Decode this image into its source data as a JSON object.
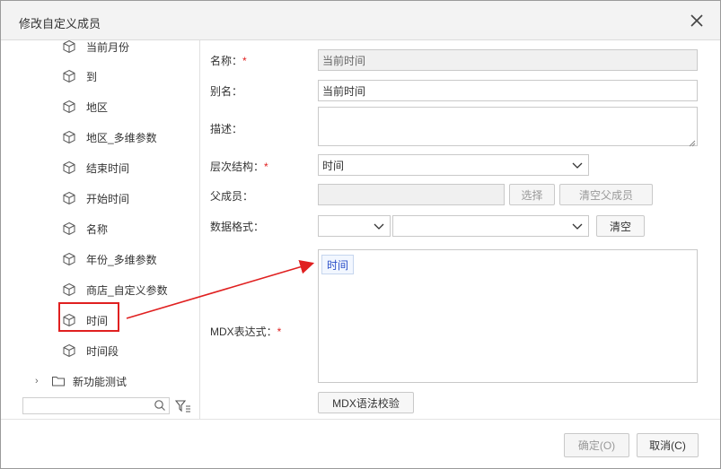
{
  "dialog": {
    "title": "修改自定义成员",
    "close_icon": "close-icon"
  },
  "tree": {
    "items": [
      {
        "label": "当前月份",
        "icon": "cube-icon"
      },
      {
        "label": "到",
        "icon": "cube-icon"
      },
      {
        "label": "地区",
        "icon": "cube-icon"
      },
      {
        "label": "地区_多维参数",
        "icon": "cube-icon"
      },
      {
        "label": "结束时间",
        "icon": "cube-icon"
      },
      {
        "label": "开始时间",
        "icon": "cube-icon"
      },
      {
        "label": "名称",
        "icon": "cube-icon"
      },
      {
        "label": "年份_多维参数",
        "icon": "cube-icon"
      },
      {
        "label": "商店_自定义参数",
        "icon": "cube-icon"
      },
      {
        "label": "时间",
        "icon": "cube-icon",
        "highlighted": true
      },
      {
        "label": "时间段",
        "icon": "cube-icon"
      }
    ],
    "folder": {
      "label": "新功能测试",
      "icon": "folder-icon"
    },
    "search_placeholder": "",
    "search_icon": "search-icon",
    "filter_icon": "filter-icon"
  },
  "form": {
    "name_label": "名称：",
    "name_required": "*",
    "name_value": "当前时间",
    "alias_label": "别名：",
    "alias_value": "当前时间",
    "desc_label": "描述：",
    "desc_value": "",
    "hierarchy_label": "层次结构：",
    "hierarchy_required": "*",
    "hierarchy_value": "时间",
    "parent_label": "父成员：",
    "parent_value": "",
    "select_button": "选择",
    "clear_parent_button": "清空父成员",
    "format_label": "数据格式：",
    "format_type_value": "",
    "format_value": "",
    "clear_button": "清空",
    "mdx_label": "MDX表达式：",
    "mdx_required": "*",
    "mdx_chip": "时间",
    "mdx_check_button": "MDX语法校验"
  },
  "footer": {
    "ok_button": "确定(O)",
    "cancel_button": "取消(C)"
  },
  "colors": {
    "accent_red": "#e02020",
    "chip_text": "#2b4fc8"
  }
}
